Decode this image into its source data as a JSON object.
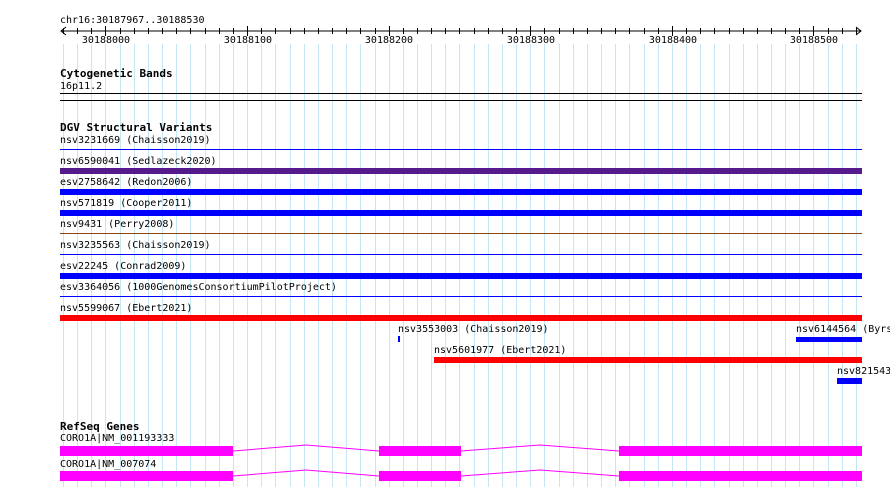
{
  "ruler": {
    "locus": "chr16:30187967..30188530",
    "ticks": [
      "30188000",
      "30188100",
      "30188200",
      "30188300",
      "30188400",
      "30188500"
    ]
  },
  "cytobands": {
    "title": "Cytogenetic Bands",
    "band": "16p11.2"
  },
  "dgv": {
    "title": "DGV Structural Variants",
    "variants": [
      {
        "label": "nsv3231669 (Chaisson2019)",
        "color": "#0000ff",
        "style": "line"
      },
      {
        "label": "nsv6590041 (Sedlazeck2020)",
        "color": "#551a8b",
        "style": "bar"
      },
      {
        "label": "esv2758642 (Redon2006)",
        "color": "#0000ff",
        "style": "bar"
      },
      {
        "label": "nsv571819 (Cooper2011)",
        "color": "#0000ff",
        "style": "bar"
      },
      {
        "label": "nsv9431 (Perry2008)",
        "color": "#8b4513",
        "style": "line"
      },
      {
        "label": "nsv3235563 (Chaisson2019)",
        "color": "#0000ff",
        "style": "line"
      },
      {
        "label": "esv22245 (Conrad2009)",
        "color": "#0000ff",
        "style": "bar"
      },
      {
        "label": "esv3364056 (1000GenomesConsortiumPilotProject)",
        "color": "#0000ff",
        "style": "line"
      },
      {
        "label": "nsv5599067 (Ebert2021)",
        "color": "#ff0000",
        "style": "bar"
      }
    ],
    "extra": [
      {
        "label": "nsv3553003 (Chaisson2019)",
        "color": "#0000ff"
      },
      {
        "label": "nsv6144564 (Byrs",
        "color": "#0000ff"
      },
      {
        "label": "nsv5601977 (Ebert2021)",
        "color": "#ff0000"
      },
      {
        "label": "nsv821543",
        "color": "#0000ff"
      }
    ]
  },
  "refseq": {
    "title": "RefSeq Genes",
    "color": "#ff00ff",
    "transcripts": [
      {
        "label": "CORO1A|NM_001193333"
      },
      {
        "label": "CORO1A|NM_007074"
      }
    ]
  }
}
